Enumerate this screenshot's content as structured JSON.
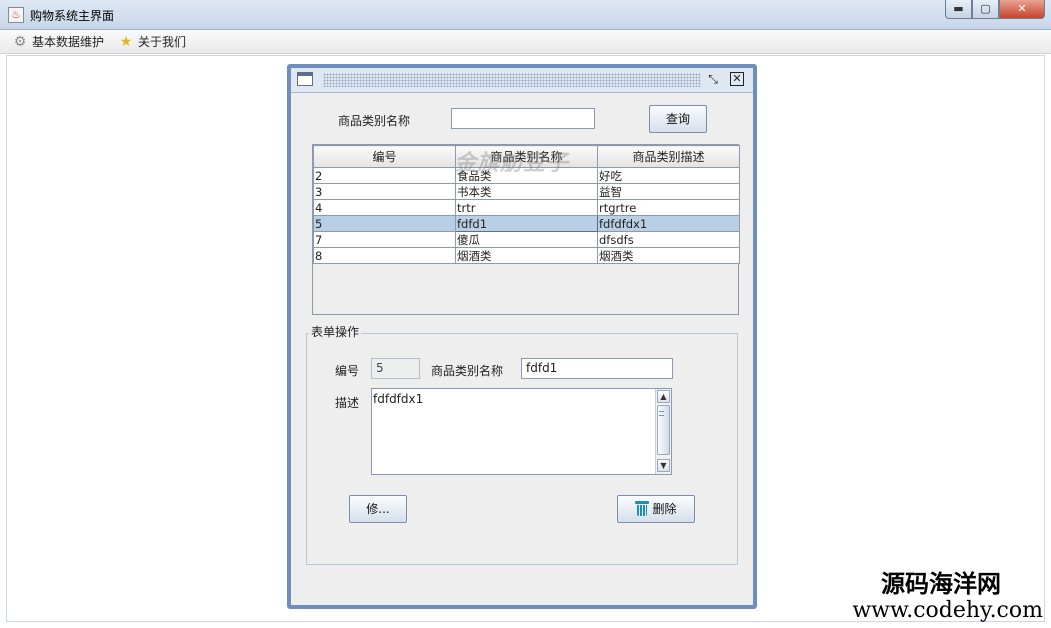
{
  "window": {
    "title": "购物系统主界面",
    "controls": {
      "minimize": "▬",
      "maximize": "▢",
      "close": "✕"
    }
  },
  "menubar": {
    "items": [
      {
        "label": "基本数据维护",
        "icon": "gear-icon"
      },
      {
        "label": "关于我们",
        "icon": "star-icon"
      }
    ]
  },
  "inner_frame": {
    "restore_glyph": "⤡",
    "close_glyph": "✕"
  },
  "search": {
    "label": "商品类别名称",
    "value": "",
    "button": "查询"
  },
  "table": {
    "headers": [
      "编号",
      "商品类别名称",
      "商品类别描述"
    ],
    "rows": [
      [
        "2",
        "食品类",
        "好吃"
      ],
      [
        "3",
        "书本类",
        "益智"
      ],
      [
        "4",
        "trtr",
        "rtgrtre"
      ],
      [
        "5",
        "fdfd1",
        "fdfdfdx1"
      ],
      [
        "7",
        "傻瓜",
        "dfsdfs"
      ],
      [
        "8",
        "烟酒类",
        "烟酒类"
      ]
    ],
    "selected_row": 3,
    "watermark": "金旗舫豆子"
  },
  "form": {
    "group_title": "表单操作",
    "id_label": "编号",
    "id_value": "5",
    "name_label": "商品类别名称",
    "name_value": "fdfd1",
    "desc_label": "描述",
    "desc_value": "fdfdfdx1",
    "modify_button": "修...",
    "delete_button": "删除"
  },
  "site_watermark": {
    "line1": "源码海洋网",
    "line2": "www.codehy.com"
  },
  "colors": {
    "frame_border": "#6f8dbd",
    "selection": "#b8cfe5",
    "trash": "#1c8fb8"
  }
}
